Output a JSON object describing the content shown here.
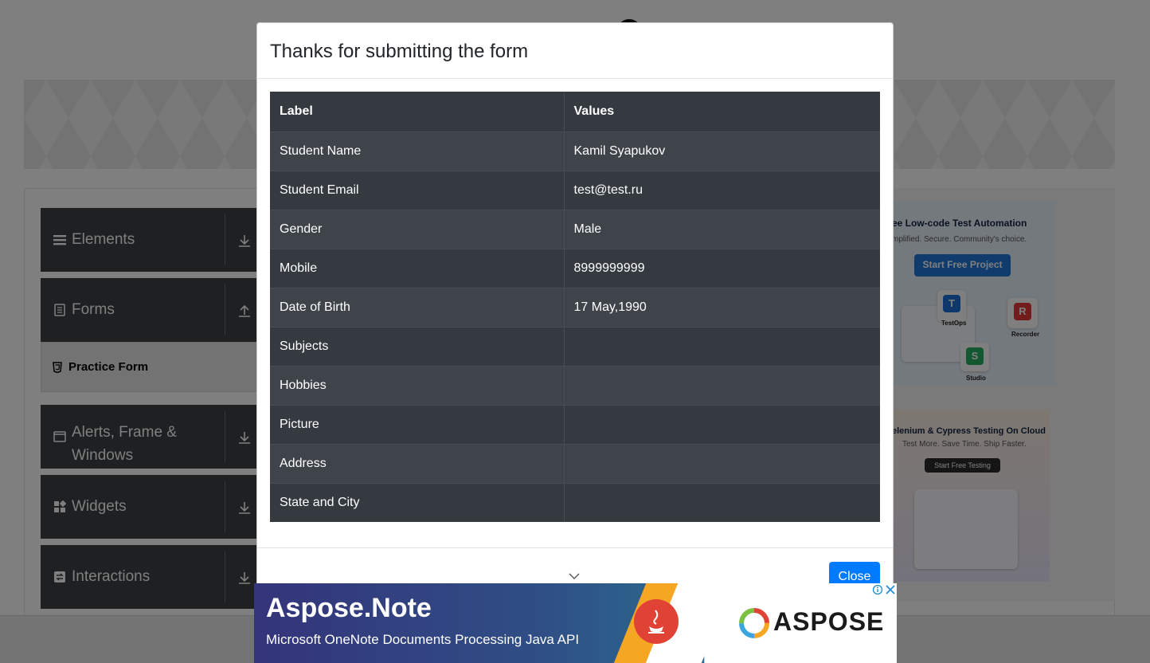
{
  "sidebar": {
    "groups": [
      {
        "label": "Elements"
      },
      {
        "label": "Forms"
      },
      {
        "label": "Alerts, Frame & Windows"
      },
      {
        "label": "Widgets"
      },
      {
        "label": "Interactions"
      }
    ],
    "active_item": "Practice Form"
  },
  "side_ads": {
    "ad1": {
      "title": "ee Low-code Test Automation",
      "subtitle": "mplified. Secure. Community's choice.",
      "button": "Start Free Project",
      "tiles": [
        "TestOps",
        "Recorder",
        "Studio"
      ]
    },
    "ad2": {
      "title": "elenium & Cypress Testing On Cloud",
      "subtitle": "Test More. Save Time. Ship Faster.",
      "button": "Start Free Testing"
    }
  },
  "modal": {
    "title": "Thanks for submitting the form",
    "headers": {
      "label": "Label",
      "values": "Values"
    },
    "rows": [
      {
        "label": "Student Name",
        "value": "Kamil Syapukov"
      },
      {
        "label": "Student Email",
        "value": "test@test.ru"
      },
      {
        "label": "Gender",
        "value": "Male"
      },
      {
        "label": "Mobile",
        "value": "8999999999"
      },
      {
        "label": "Date of Birth",
        "value": "17 May,1990"
      },
      {
        "label": "Subjects",
        "value": ""
      },
      {
        "label": "Hobbies",
        "value": ""
      },
      {
        "label": "Picture",
        "value": ""
      },
      {
        "label": "Address",
        "value": ""
      },
      {
        "label": "State and City",
        "value": ""
      }
    ],
    "close_label": "Close"
  },
  "bottom_ad": {
    "headline": "Aspose.Note",
    "tagline": "Microsoft OneNote Documents Processing  Java API",
    "brand": "ASPOSE"
  }
}
